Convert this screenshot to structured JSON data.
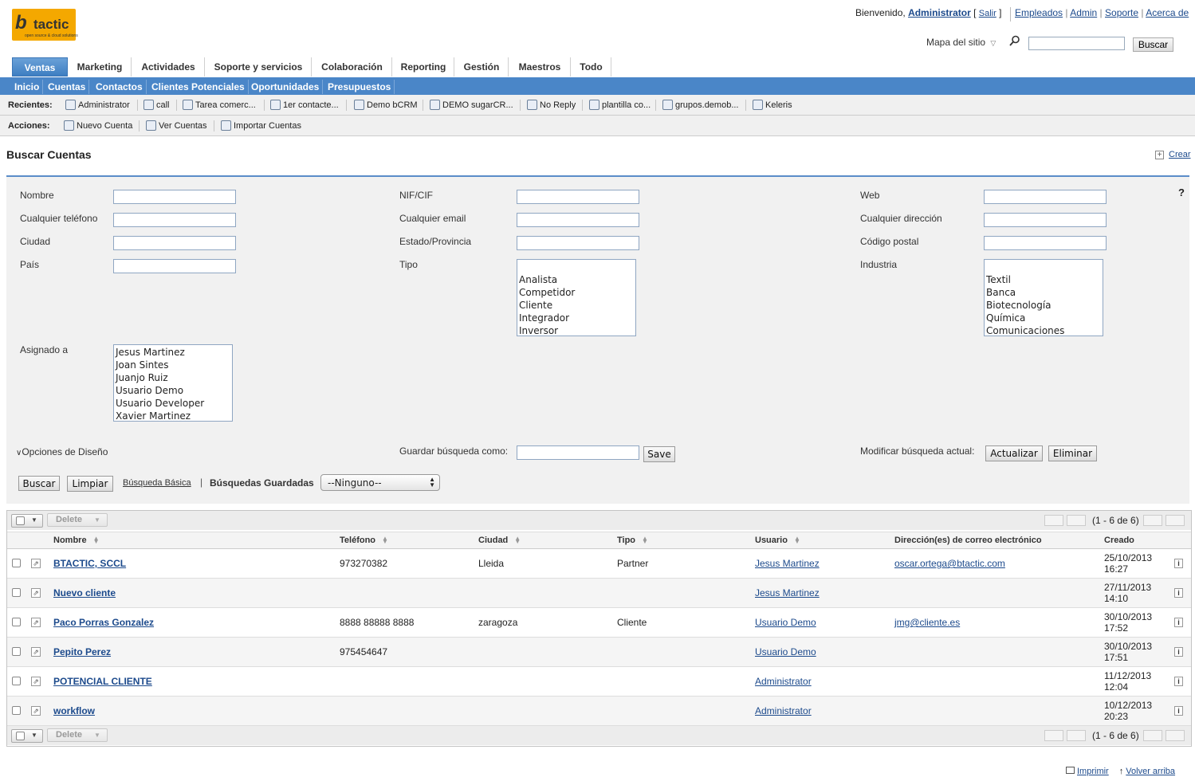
{
  "logo": {
    "mark": "b",
    "brand": "tactic",
    "tagline": "open source & cloud solutions"
  },
  "header": {
    "welcome": "Bienvenido,",
    "user": "Administrator",
    "salir": "Salir",
    "links": [
      "Empleados",
      "Admin",
      "Soporte",
      "Acerca de"
    ],
    "sitemap": "Mapa del sitio",
    "search_button": "Buscar"
  },
  "tabs": [
    "Ventas",
    "Marketing",
    "Actividades",
    "Soporte y servicios",
    "Colaboración",
    "Reporting",
    "Gestión",
    "Maestros",
    "Todo"
  ],
  "subtabs": [
    "Inicio",
    "Cuentas",
    "Contactos",
    "Clientes Potenciales",
    "Oportunidades",
    "Presupuestos"
  ],
  "recent": {
    "label": "Recientes:",
    "items": [
      "Administrator",
      "call",
      "Tarea comerc...",
      "1er contacte...",
      "Demo bCRM",
      "DEMO sugarCR...",
      "No Reply",
      "plantilla co...",
      "grupos.demob...",
      "Keleris"
    ]
  },
  "actions": {
    "label": "Acciones:",
    "items": [
      "Nuevo Cuenta",
      "Ver Cuentas",
      "Importar Cuentas"
    ]
  },
  "page": {
    "title": "Buscar Cuentas",
    "crear": "Crear"
  },
  "form": {
    "labels": {
      "nombre": "Nombre",
      "telefono": "Cualquier teléfono",
      "ciudad": "Ciudad",
      "pais": "País",
      "nif": "NIF/CIF",
      "email": "Cualquier email",
      "estado": "Estado/Provincia",
      "tipo": "Tipo",
      "web": "Web",
      "direccion": "Cualquier dirección",
      "cp": "Código postal",
      "industria": "Industria",
      "asignado": "Asignado a"
    },
    "tipo_options": [
      "Analista",
      "Competidor",
      "Cliente",
      "Integrador",
      "Inversor"
    ],
    "industria_options": [
      "Textil",
      "Banca",
      "Biotecnología",
      "Química",
      "Comunicaciones"
    ],
    "asignado_options": [
      "Jesus Martinez",
      "Joan Sintes",
      "Juanjo Ruiz",
      "Usuario Demo",
      "Usuario Developer",
      "Xavier Martinez"
    ],
    "layout_options": "Opciones de Diseño",
    "save_search_label": "Guardar búsqueda como:",
    "save_button": "Save",
    "modify_label": "Modificar búsqueda actual:",
    "update_button": "Actualizar",
    "delete_button": "Eliminar",
    "search_button": "Buscar",
    "clear_button": "Limpiar",
    "basic_search": "Búsqueda Básica",
    "saved_searches_label": "Búsquedas Guardadas",
    "saved_searches_value": "--Ninguno--",
    "help": "?"
  },
  "list": {
    "delete_label": "Delete",
    "count": "(1 - 6 de 6)",
    "columns": [
      "Nombre",
      "Teléfono",
      "Ciudad",
      "Tipo",
      "Usuario",
      "Dirección(es) de correo electrónico",
      "Creado"
    ],
    "rows": [
      {
        "name": "BTACTIC, SCCL",
        "phone": "973270382",
        "city": "Lleida",
        "type": "Partner",
        "user": "Jesus Martinez",
        "email": "oscar.ortega@btactic.com",
        "date": "25/10/2013",
        "time": "16:27"
      },
      {
        "name": "Nuevo cliente",
        "phone": "",
        "city": "",
        "type": "",
        "user": "Jesus Martinez",
        "email": "",
        "date": "27/11/2013",
        "time": "14:10"
      },
      {
        "name": "Paco Porras Gonzalez",
        "phone": "8888 88888 8888",
        "city": "zaragoza",
        "type": "Cliente",
        "user": "Usuario Demo",
        "email": "jmg@cliente.es",
        "date": "30/10/2013",
        "time": "17:52"
      },
      {
        "name": "Pepito Perez",
        "phone": "975454647",
        "city": "",
        "type": "",
        "user": "Usuario Demo",
        "email": "",
        "date": "30/10/2013",
        "time": "17:51"
      },
      {
        "name": "POTENCIAL CLIENTE",
        "phone": "",
        "city": "",
        "type": "",
        "user": "Administrator",
        "email": "",
        "date": "11/12/2013",
        "time": "12:04"
      },
      {
        "name": "workflow",
        "phone": "",
        "city": "",
        "type": "",
        "user": "Administrator",
        "email": "",
        "date": "10/12/2013",
        "time": "20:23"
      }
    ]
  },
  "footer": {
    "print": "Imprimir",
    "back_top": "Volver arriba"
  }
}
